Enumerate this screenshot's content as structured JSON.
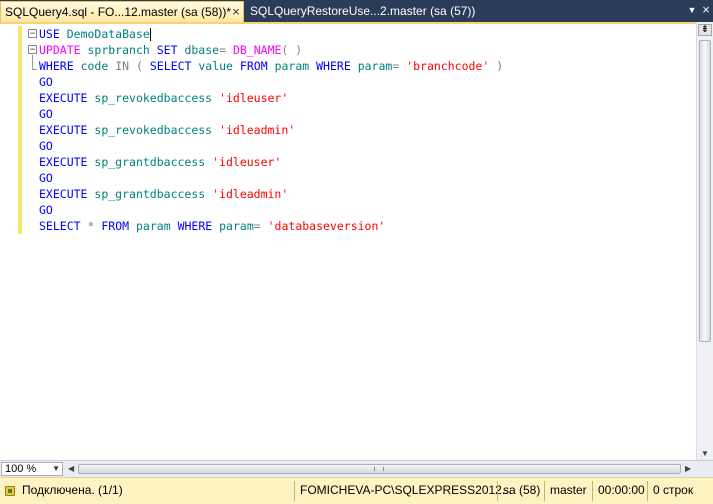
{
  "tabs": [
    {
      "label": "SQLQuery4.sql - FO...12.master (sa (58))*",
      "active": true,
      "close_glyph": "×"
    },
    {
      "label": "SQLQueryRestoreUse...2.master (sa (57))",
      "active": false
    }
  ],
  "tabstrip": {
    "dropdown_glyph": "▼",
    "close_glyph": "×"
  },
  "editor": {
    "lines": [
      [
        {
          "t": "kw",
          "v": "USE"
        },
        {
          "t": "sp",
          "v": " "
        },
        {
          "t": "id",
          "v": "DemoDataBase"
        }
      ],
      [
        {
          "t": "fn",
          "v": "UPDATE"
        },
        {
          "t": "sp",
          "v": " "
        },
        {
          "t": "id",
          "v": "sprbranch"
        },
        {
          "t": "sp",
          "v": " "
        },
        {
          "t": "kw",
          "v": "SET"
        },
        {
          "t": "sp",
          "v": " "
        },
        {
          "t": "id",
          "v": "dbase"
        },
        {
          "t": "op",
          "v": "="
        },
        {
          "t": "sp",
          "v": " "
        },
        {
          "t": "fn",
          "v": "DB_NAME"
        },
        {
          "t": "op",
          "v": "( )"
        }
      ],
      [
        {
          "t": "kw",
          "v": "WHERE"
        },
        {
          "t": "sp",
          "v": " "
        },
        {
          "t": "id",
          "v": "code"
        },
        {
          "t": "sp",
          "v": " "
        },
        {
          "t": "op",
          "v": "IN"
        },
        {
          "t": "sp",
          "v": " "
        },
        {
          "t": "op",
          "v": "("
        },
        {
          "t": "sp",
          "v": " "
        },
        {
          "t": "kw",
          "v": "SELECT"
        },
        {
          "t": "sp",
          "v": " "
        },
        {
          "t": "id",
          "v": "value"
        },
        {
          "t": "sp",
          "v": " "
        },
        {
          "t": "kw",
          "v": "FROM"
        },
        {
          "t": "sp",
          "v": " "
        },
        {
          "t": "id",
          "v": "param"
        },
        {
          "t": "sp",
          "v": " "
        },
        {
          "t": "kw",
          "v": "WHERE"
        },
        {
          "t": "sp",
          "v": " "
        },
        {
          "t": "id",
          "v": "param"
        },
        {
          "t": "op",
          "v": "="
        },
        {
          "t": "sp",
          "v": " "
        },
        {
          "t": "str",
          "v": "'branchcode'"
        },
        {
          "t": "sp",
          "v": " "
        },
        {
          "t": "op",
          "v": ")"
        }
      ],
      [
        {
          "t": "kw",
          "v": "GO"
        }
      ],
      [
        {
          "t": "kw",
          "v": "EXECUTE"
        },
        {
          "t": "sp",
          "v": " "
        },
        {
          "t": "id",
          "v": "sp_revokedbaccess"
        },
        {
          "t": "sp",
          "v": " "
        },
        {
          "t": "str",
          "v": "'idleuser'"
        }
      ],
      [
        {
          "t": "kw",
          "v": "GO"
        }
      ],
      [
        {
          "t": "kw",
          "v": "EXECUTE"
        },
        {
          "t": "sp",
          "v": " "
        },
        {
          "t": "id",
          "v": "sp_revokedbaccess"
        },
        {
          "t": "sp",
          "v": " "
        },
        {
          "t": "str",
          "v": "'idleadmin'"
        }
      ],
      [
        {
          "t": "kw",
          "v": "GO"
        }
      ],
      [
        {
          "t": "kw",
          "v": "EXECUTE"
        },
        {
          "t": "sp",
          "v": " "
        },
        {
          "t": "id",
          "v": "sp_grantdbaccess"
        },
        {
          "t": "sp",
          "v": " "
        },
        {
          "t": "str",
          "v": "'idleuser'"
        }
      ],
      [
        {
          "t": "kw",
          "v": "GO"
        }
      ],
      [
        {
          "t": "kw",
          "v": "EXECUTE"
        },
        {
          "t": "sp",
          "v": " "
        },
        {
          "t": "id",
          "v": "sp_grantdbaccess"
        },
        {
          "t": "sp",
          "v": " "
        },
        {
          "t": "str",
          "v": "'idleadmin'"
        }
      ],
      [
        {
          "t": "kw",
          "v": "GO"
        }
      ],
      [
        {
          "t": "kw",
          "v": "SELECT"
        },
        {
          "t": "sp",
          "v": " "
        },
        {
          "t": "op",
          "v": "*"
        },
        {
          "t": "sp",
          "v": " "
        },
        {
          "t": "kw",
          "v": "FROM"
        },
        {
          "t": "sp",
          "v": " "
        },
        {
          "t": "id",
          "v": "param"
        },
        {
          "t": "sp",
          "v": " "
        },
        {
          "t": "kw",
          "v": "WHERE"
        },
        {
          "t": "sp",
          "v": " "
        },
        {
          "t": "id",
          "v": "param"
        },
        {
          "t": "op",
          "v": "="
        },
        {
          "t": "sp",
          "v": " "
        },
        {
          "t": "str",
          "v": "'databaseversion'"
        }
      ]
    ],
    "fold_minus": "−"
  },
  "scroll": {
    "split_glyph": "⇟",
    "down_glyph": "▼",
    "left_glyph": "◀",
    "right_glyph": "▶"
  },
  "zoom": {
    "value": "100 %",
    "dd_glyph": "▼"
  },
  "status": {
    "connection": "Подключена. (1/1)",
    "server": "FOMICHEVA-PC\\SQLEXPRESS2012...",
    "user": "sa (58)",
    "database": "master",
    "elapsed": "00:00:00",
    "rows": "0 строк"
  },
  "colors": {
    "kw": "#0000ff",
    "id": "#008080",
    "fn": "#ff00ff",
    "str": "#ff0000",
    "op": "#808080"
  }
}
